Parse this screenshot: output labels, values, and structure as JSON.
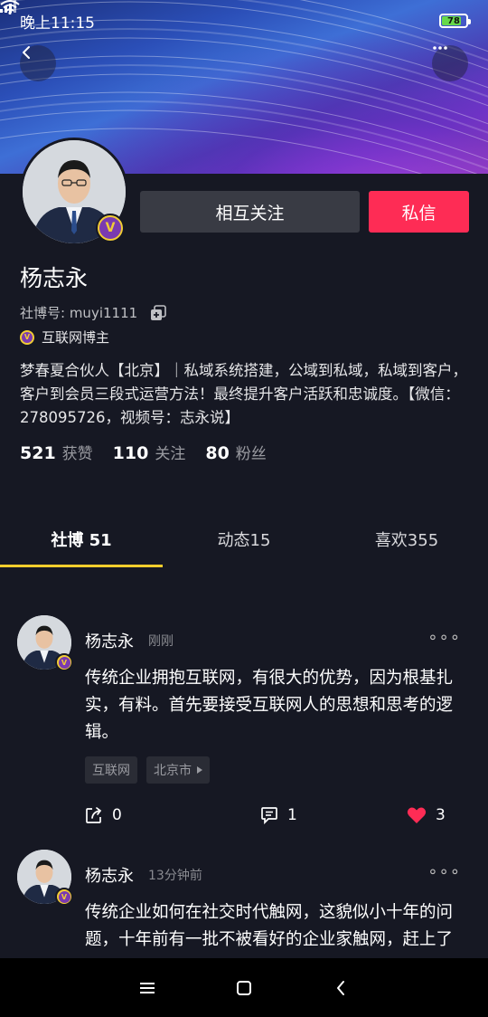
{
  "status_bar": {
    "time": "晚上11:15",
    "battery_level": "78",
    "battery_color": "#67d94a"
  },
  "header": {
    "back_icon": "chevron-left-icon",
    "more_icon": "more-horizontal-icon"
  },
  "profile": {
    "name": "杨志永",
    "id_label": "社博号: muyi1111",
    "role": "互联网博主",
    "badge_letter": "V",
    "bio": "梦春夏合伙人【北京】｜私域系统搭建，公域到私域，私域到客户，客户到会员三段式运营方法！最终提升客户活跃和忠诚度。【微信：278095726，视频号：志永说】",
    "follow_button": "相互关注",
    "message_button": "私信",
    "accent_color": "#fe2c55"
  },
  "stats": [
    {
      "value": "521",
      "label": "获赞"
    },
    {
      "value": "110",
      "label": "关注"
    },
    {
      "value": "80",
      "label": "粉丝"
    }
  ],
  "tabs": [
    {
      "label": "社博 51",
      "active": true
    },
    {
      "label": "动态15",
      "active": false
    },
    {
      "label": "喜欢355",
      "active": false
    }
  ],
  "posts": [
    {
      "author": "杨志永",
      "time": "刚刚",
      "text": "传统企业拥抱互联网，有很大的优势，因为根基扎实，有料。首先要接受互联网人的思想和思考的逻辑。",
      "tags": [
        "互联网",
        "北京市"
      ],
      "share_count": "0",
      "comment_count": "1",
      "like_count": "3"
    },
    {
      "author": "杨志永",
      "time": "13分钟前",
      "text": "传统企业如何在社交时代触网，这貌似小十年的问题，十年前有一批不被看好的企业家触网，赶上了"
    }
  ]
}
